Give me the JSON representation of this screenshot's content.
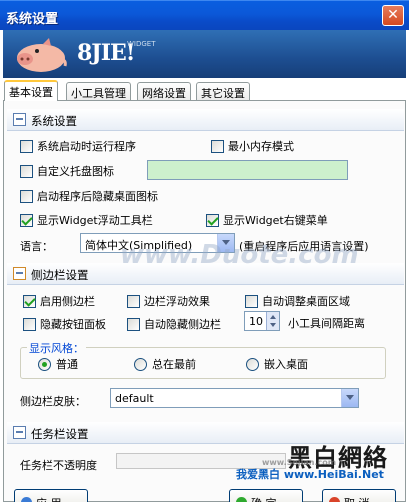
{
  "window": {
    "title": "系统设置"
  },
  "banner": {
    "logo_text": "8JIE!",
    "widget_text": "WIDGET"
  },
  "tabs": [
    {
      "label": "基本设置"
    },
    {
      "label": "小工具管理"
    },
    {
      "label": "网络设置"
    },
    {
      "label": "其它设置"
    }
  ],
  "system": {
    "header": "系统设置",
    "run_on_startup": {
      "label": "系统启动时运行程序",
      "checked": false
    },
    "min_memory": {
      "label": "最小内存模式",
      "checked": false
    },
    "custom_tray": {
      "label": "自定义托盘图标",
      "checked": false
    },
    "hide_desktop_icons": {
      "label": "启动程序后隐藏桌面图标",
      "checked": false
    },
    "show_float_bar": {
      "label": "显示Widget浮动工具栏",
      "checked": true
    },
    "show_context_menu": {
      "label": "显示Widget右键菜单",
      "checked": true
    },
    "language_label": "语言：",
    "language_value": "简体中文(Simplified)",
    "language_note": "(重启程序后应用语言设置)"
  },
  "sidebar": {
    "header": "侧边栏设置",
    "enable": {
      "label": "启用侧边栏",
      "checked": true
    },
    "float_effect": {
      "label": "边栏浮动效果",
      "checked": false
    },
    "auto_adjust": {
      "label": "自动调整桌面区域",
      "checked": false
    },
    "hide_buttons": {
      "label": "隐藏按钮面板",
      "checked": false
    },
    "auto_hide": {
      "label": "自动隐藏侧边栏",
      "checked": false
    },
    "gap_value": "10",
    "gap_label": "小工具间隔距离",
    "style_group_label": "显示风格：",
    "style_normal": "普通",
    "style_topmost": "总在最前",
    "style_embed": "嵌入桌面",
    "skin_label": "侧边栏皮肤：",
    "skin_value": "default"
  },
  "taskbar": {
    "header": "任务栏设置",
    "opacity_label": "任务栏不透明度"
  },
  "buttons": {
    "apply": "应 用",
    "ok": "确 定",
    "cancel": "取 消"
  },
  "watermarks": {
    "center": "www.Duote.com",
    "logo": "黑白網絡",
    "url": "我爱黑白 www.HeiBai.Net",
    "small": "www.Sejian.com"
  },
  "colors": {
    "titlebar": "#0a58d8",
    "accent_check": "#21a121",
    "textbox_bg": "#cdf0cd",
    "group_label": "#0046d5"
  }
}
